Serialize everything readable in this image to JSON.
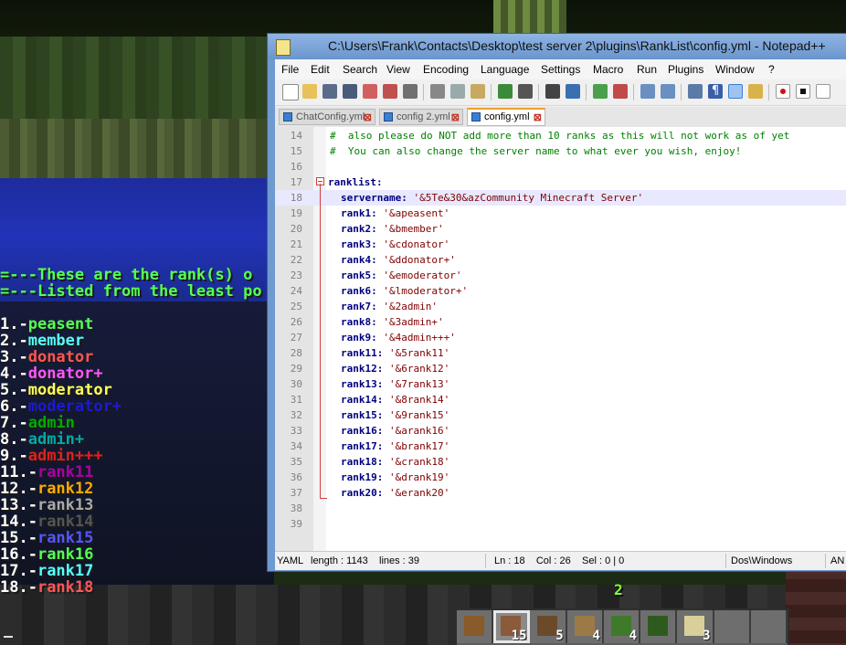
{
  "game": {
    "chat_header": [
      "=---These are the rank(s) o",
      "=---Listed from the least po"
    ],
    "ranks": [
      {
        "num": "1.-",
        "name": "peasent",
        "color": "#55ff55"
      },
      {
        "num": "2.-",
        "name": "member",
        "color": "#55ffff"
      },
      {
        "num": "3.-",
        "name": "donator",
        "color": "#ff5555"
      },
      {
        "num": "4.-",
        "name": "donator+",
        "color": "#ff55ff"
      },
      {
        "num": "5.-",
        "name": "moderator",
        "color": "#ffff55"
      },
      {
        "num": "6.-",
        "name": "moderator+",
        "color": "#1a1ad8"
      },
      {
        "num": "7.-",
        "name": "admin",
        "color": "#00aa00"
      },
      {
        "num": "8.-",
        "name": "admin+",
        "color": "#00aaaa"
      },
      {
        "num": "9.-",
        "name": "admin+++",
        "color": "#e02020"
      },
      {
        "num": "11.-",
        "name": "rank11",
        "color": "#aa00aa"
      },
      {
        "num": "12.-",
        "name": "rank12",
        "color": "#ffaa00"
      },
      {
        "num": "13.-",
        "name": "rank13",
        "color": "#aaaaaa"
      },
      {
        "num": "14.-",
        "name": "rank14",
        "color": "#555555"
      },
      {
        "num": "15.-",
        "name": "rank15",
        "color": "#5555ff"
      },
      {
        "num": "16.-",
        "name": "rank16",
        "color": "#55ff55"
      },
      {
        "num": "17.-",
        "name": "rank17",
        "color": "#55ffff"
      },
      {
        "num": "18.-",
        "name": "rank18",
        "color": "#ff5555"
      }
    ],
    "xp_level": "2",
    "hotbar": [
      {
        "icon": "pickaxe-icon",
        "count": ""
      },
      {
        "icon": "dirt-block-icon",
        "count": "15"
      },
      {
        "icon": "seeds-icon",
        "count": "5"
      },
      {
        "icon": "wood-log-icon",
        "count": "4"
      },
      {
        "icon": "sapling-icon",
        "count": "4"
      },
      {
        "icon": "leaves-icon",
        "count": ""
      },
      {
        "icon": "sand-block-icon",
        "count": "3"
      },
      {
        "icon": "empty-slot",
        "count": ""
      },
      {
        "icon": "empty-slot",
        "count": ""
      }
    ]
  },
  "notepad": {
    "title": "C:\\Users\\Frank\\Contacts\\Desktop\\test server 2\\plugins\\RankList\\config.yml - Notepad++",
    "menu": [
      "File",
      "Edit",
      "Search",
      "View",
      "Encoding",
      "Language",
      "Settings",
      "Macro",
      "Run",
      "Plugins",
      "Window",
      "?"
    ],
    "tabs": [
      {
        "label": "ChatConfig.yml",
        "active": false
      },
      {
        "label": "config 2.yml",
        "active": false
      },
      {
        "label": "config.yml",
        "active": true
      }
    ],
    "lines": [
      {
        "n": "14",
        "type": "comment",
        "text": "#  also please do NOT add more than 10 ranks as this will not work as of yet"
      },
      {
        "n": "15",
        "type": "comment",
        "text": "#  You can also change the server name to what ever you wish, enjoy!"
      },
      {
        "n": "16",
        "type": "blank",
        "text": ""
      },
      {
        "n": "17",
        "type": "section",
        "key": "ranklist:"
      },
      {
        "n": "18",
        "type": "kv",
        "key": "servername:",
        "val": "'&5Te&30&azCommunity Minecraft Server'"
      },
      {
        "n": "19",
        "type": "kv",
        "key": "rank1:",
        "val": "'&apeasent'"
      },
      {
        "n": "20",
        "type": "kv",
        "key": "rank2:",
        "val": "'&bmember'"
      },
      {
        "n": "21",
        "type": "kv",
        "key": "rank3:",
        "val": "'&cdonator'"
      },
      {
        "n": "22",
        "type": "kv",
        "key": "rank4:",
        "val": "'&ddonator+'"
      },
      {
        "n": "23",
        "type": "kv",
        "key": "rank5:",
        "val": "'&emoderator'"
      },
      {
        "n": "24",
        "type": "kv",
        "key": "rank6:",
        "val": "'&lmoderator+'"
      },
      {
        "n": "25",
        "type": "kv",
        "key": "rank7:",
        "val": "'&2admin'"
      },
      {
        "n": "26",
        "type": "kv",
        "key": "rank8:",
        "val": "'&3admin+'"
      },
      {
        "n": "27",
        "type": "kv",
        "key": "rank9:",
        "val": "'&4admin+++'"
      },
      {
        "n": "28",
        "type": "kv",
        "key": "rank11:",
        "val": "'&5rank11'"
      },
      {
        "n": "29",
        "type": "kv",
        "key": "rank12:",
        "val": "'&6rank12'"
      },
      {
        "n": "30",
        "type": "kv",
        "key": "rank13:",
        "val": "'&7rank13'"
      },
      {
        "n": "31",
        "type": "kv",
        "key": "rank14:",
        "val": "'&8rank14'"
      },
      {
        "n": "32",
        "type": "kv",
        "key": "rank15:",
        "val": "'&9rank15'"
      },
      {
        "n": "33",
        "type": "kv",
        "key": "rank16:",
        "val": "'&arank16'"
      },
      {
        "n": "34",
        "type": "kv",
        "key": "rank17:",
        "val": "'&brank17'"
      },
      {
        "n": "35",
        "type": "kv",
        "key": "rank18:",
        "val": "'&crank18'"
      },
      {
        "n": "36",
        "type": "kv",
        "key": "rank19:",
        "val": "'&drank19'"
      },
      {
        "n": "37",
        "type": "kv",
        "key": "rank20:",
        "val": "'&erank20'"
      },
      {
        "n": "38",
        "type": "blank",
        "text": ""
      },
      {
        "n": "39",
        "type": "blank",
        "text": ""
      }
    ],
    "current_line": "18",
    "status": {
      "lang": "YAML",
      "length": "length : 1143",
      "lines": "lines : 39",
      "position": "Ln : 18    Col : 26    Sel : 0 | 0",
      "eol": "Dos\\Windows",
      "encoding": "AN"
    }
  }
}
